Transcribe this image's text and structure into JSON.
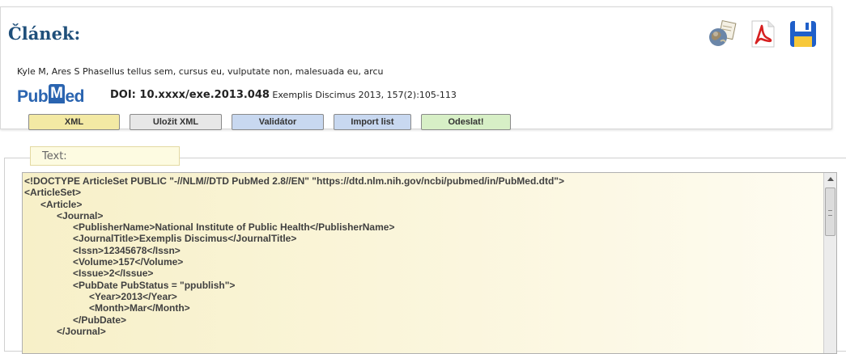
{
  "header": {
    "title": "Článek:",
    "icons": [
      "export-globe-icon",
      "pdf-icon",
      "save-disk-icon"
    ]
  },
  "article": {
    "authors": "Kyle M, Ares S Phasellus tellus sem, cursus eu, vulputate non, malesuada eu, arcu",
    "logo_pub": "Pub",
    "logo_m": "M",
    "logo_ed": "ed",
    "doi": "DOI: 10.xxxx/exe.2013.048",
    "citation": " Exemplis Discimus 2013, 157(2):105-113"
  },
  "toolbar": {
    "xml_label": "XML",
    "save_xml_label": "Uložit XML",
    "validator_label": "Validátor",
    "import_label": "Import list",
    "send_label": "Odeslat!"
  },
  "text_section": {
    "legend": "Text:",
    "content": "<!DOCTYPE ArticleSet PUBLIC \"-//NLM//DTD PubMed 2.8//EN\" \"https://dtd.nlm.nih.gov/ncbi/pubmed/in/PubMed.dtd\">\n<ArticleSet>\n      <Article>\n            <Journal>\n                  <PublisherName>National Institute of Public Health</PublisherName>\n                  <JournalTitle>Exemplis Discimus</JournalTitle>\n                  <Issn>12345678</Issn>\n                  <Volume>157</Volume>\n                  <Issue>2</Issue>\n                  <PubDate PubStatus = \"ppublish\">\n                        <Year>2013</Year>\n                        <Month>Mar</Month>\n                  </PubDate>\n            </Journal>"
  },
  "colors": {
    "heading": "#1f4f7a",
    "pubmed_blue": "#2a64b0",
    "btn_xml": "#f3e9a4",
    "btn_save": "#e7e7e7",
    "btn_blue": "#c8d8f0",
    "btn_send": "#d7efc6",
    "textarea_bg": "#fcf8e4"
  }
}
